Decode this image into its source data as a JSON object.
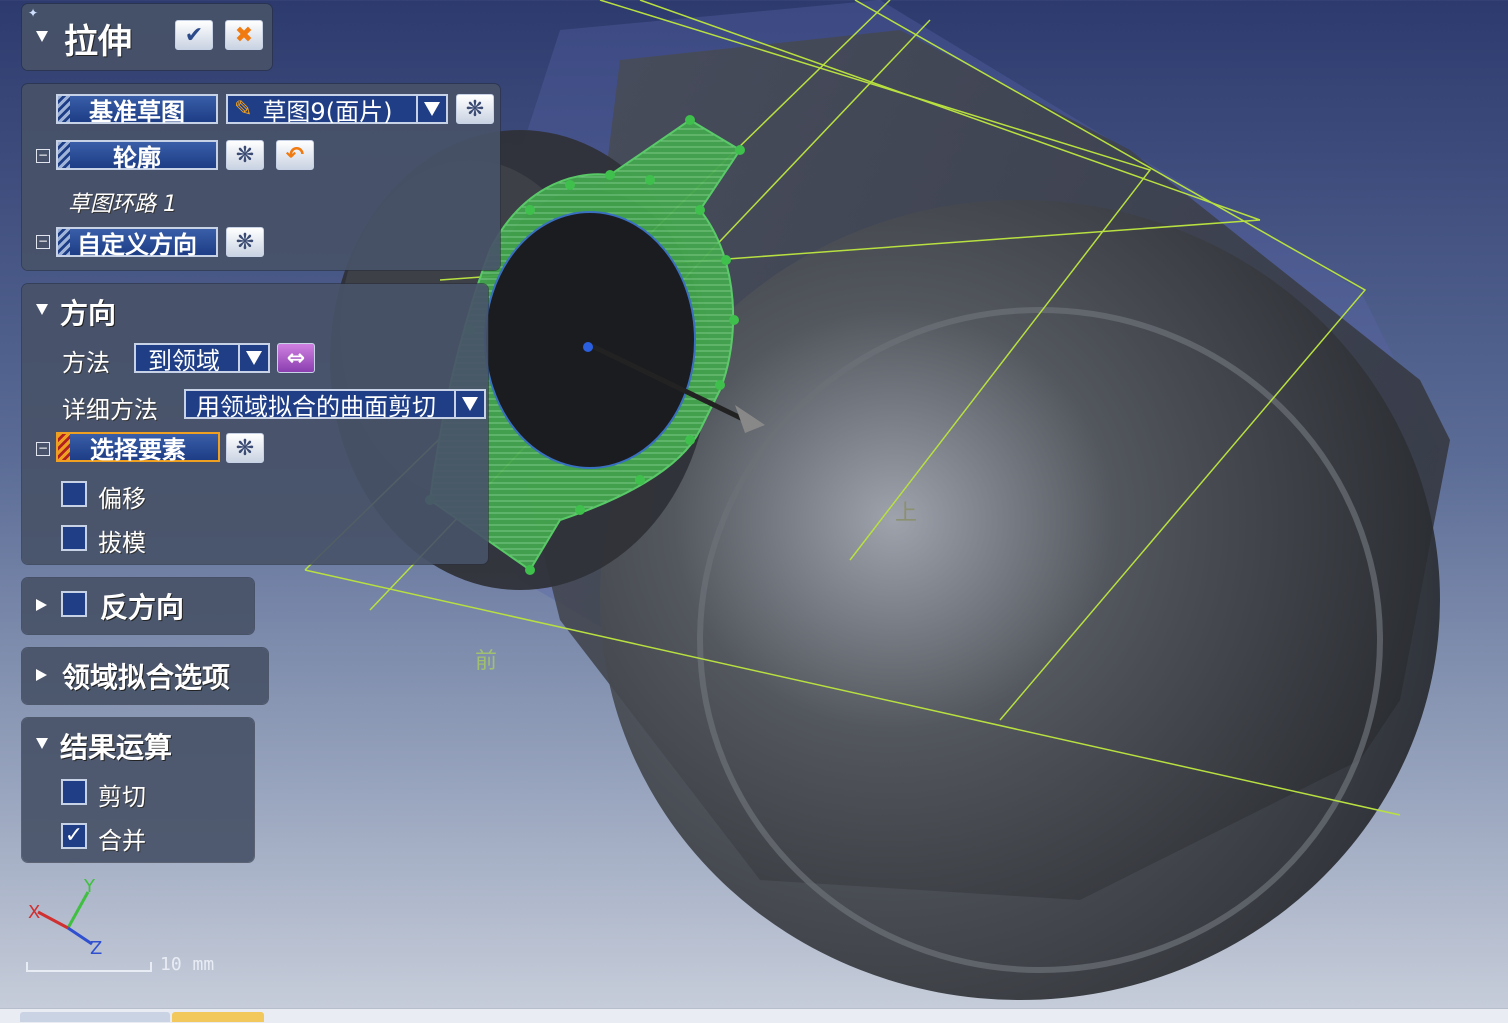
{
  "feature": {
    "title": "拉伸"
  },
  "sketch_section": {
    "base_sketch_label": "基准草图",
    "base_sketch_value": "草图9(面片)",
    "profile_label": "轮廓",
    "profile_item": "草图环路 1",
    "custom_direction_label": "自定义方向"
  },
  "direction_section": {
    "title": "方向",
    "method_label": "方法",
    "method_value": "到领域",
    "detail_label": "详细方法",
    "detail_value": "用领域拟合的曲面剪切",
    "select_label": "选择要素",
    "offset_label": "偏移",
    "offset_checked": false,
    "draft_label": "拔模",
    "draft_checked": false
  },
  "reverse_section": {
    "title": "反方向",
    "checked": false
  },
  "region_fit_section": {
    "title": "领域拟合选项"
  },
  "result_section": {
    "title": "结果运算",
    "cut_label": "剪切",
    "cut_checked": false,
    "merge_label": "合并",
    "merge_checked": true
  },
  "triad": {
    "x": "X",
    "y": "Y",
    "z": "Z"
  },
  "scale_bar": {
    "text": "10 mm"
  },
  "viewport_labels": {
    "front": "前",
    "top": "上"
  },
  "colors": {
    "panel": "#485268",
    "field": "#1f3e86",
    "accent_orange": "#f0a020",
    "sketch_green": "#3fb04a",
    "plane_line": "#b8e040"
  }
}
